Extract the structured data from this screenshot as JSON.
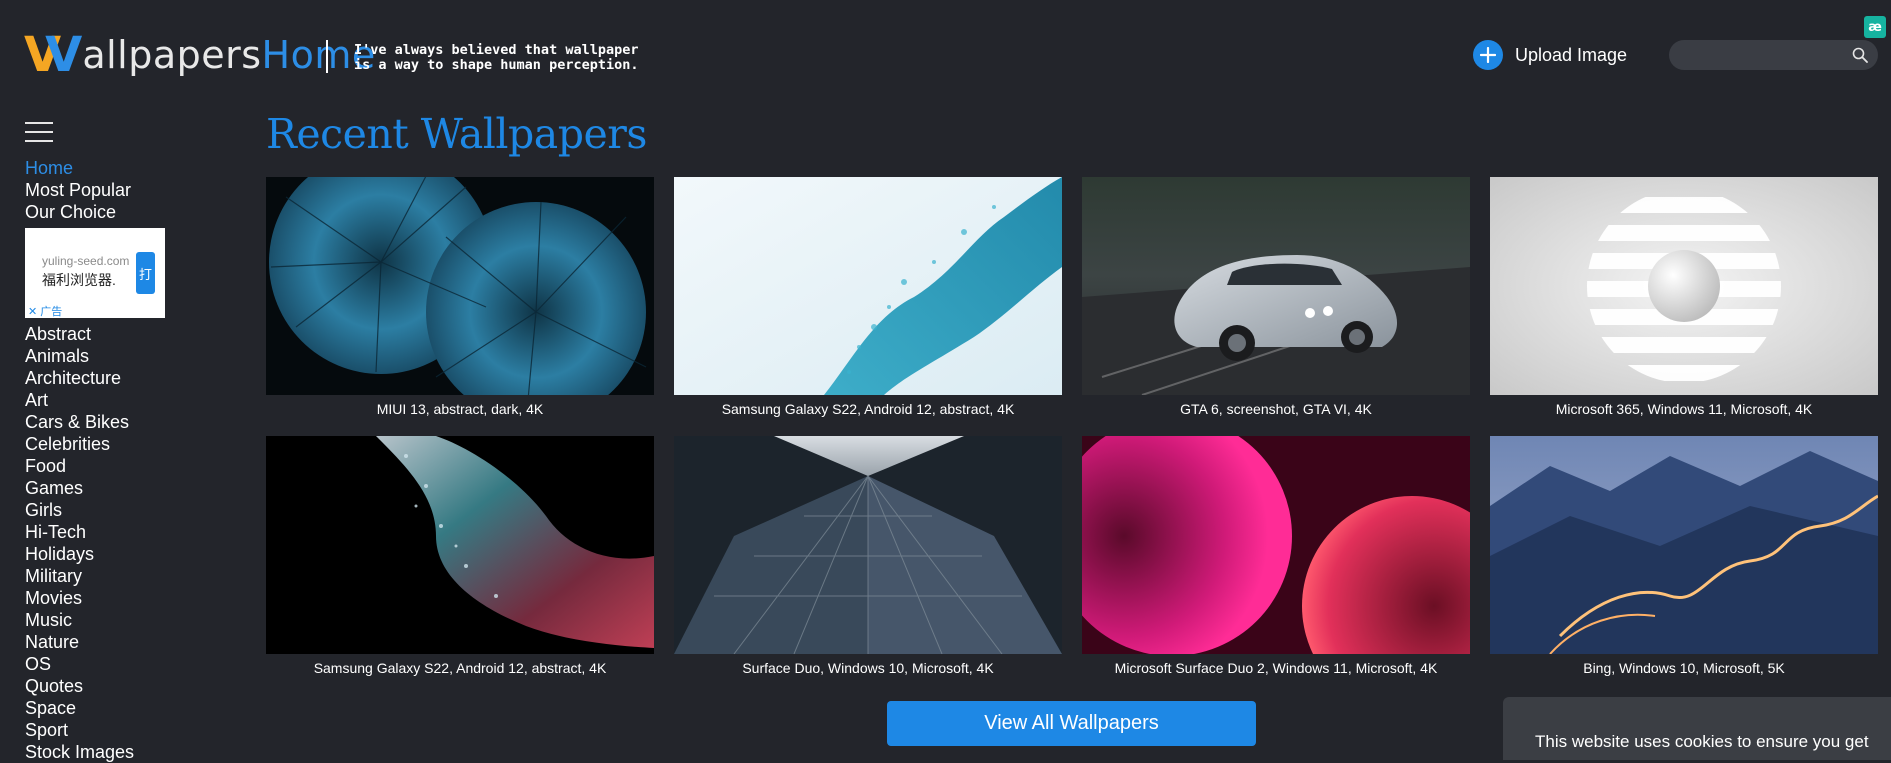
{
  "header": {
    "logo_part1": "allpapers",
    "logo_part2": "Home",
    "tagline": "I've always believed that wallpaper\nis a way to shape human perception.",
    "upload_label": "Upload Image",
    "search_placeholder": "",
    "corner_badge": "æ",
    "colors": {
      "accent": "#1e88e5",
      "logo_orange": "#f5a623",
      "background": "#23252b"
    }
  },
  "sidebar": {
    "nav": [
      {
        "label": "Home",
        "active": true
      },
      {
        "label": "Most Popular",
        "active": false
      },
      {
        "label": "Our Choice",
        "active": false
      }
    ],
    "ad": {
      "domain": "yuling-seed.com",
      "text": "福利浏览器.",
      "button": "打",
      "close_label": "✕ 广告"
    },
    "categories": [
      "Abstract",
      "Animals",
      "Architecture",
      "Art",
      "Cars & Bikes",
      "Celebrities",
      "Food",
      "Games",
      "Girls",
      "Hi-Tech",
      "Holidays",
      "Military",
      "Movies",
      "Music",
      "Nature",
      "OS",
      "Quotes",
      "Space",
      "Sport",
      "Stock Images"
    ]
  },
  "main": {
    "title": "Recent Wallpapers",
    "wallpapers": [
      {
        "caption": "MIUI 13, abstract, dark, 4K",
        "thumb": "thumb-miui-abstract-dark"
      },
      {
        "caption": "Samsung Galaxy S22, Android 12, abstract, 4K",
        "thumb": "thumb-blue-splash"
      },
      {
        "caption": "GTA 6, screenshot, GTA VI, 4K",
        "thumb": "thumb-silver-car"
      },
      {
        "caption": "Microsoft 365, Windows 11, Microsoft, 4K",
        "thumb": "thumb-white-sphere"
      },
      {
        "caption": "Samsung Galaxy S22, Android 12, abstract, 4K",
        "thumb": "thumb-particle-wave"
      },
      {
        "caption": "Surface Duo, Windows 10, Microsoft, 4K",
        "thumb": "thumb-glass-building"
      },
      {
        "caption": "Microsoft Surface Duo 2, Windows 11, Microsoft, 4K",
        "thumb": "thumb-pink-orbs"
      },
      {
        "caption": "Bing, Windows 10, Microsoft, 5K",
        "thumb": "thumb-mountain-road"
      }
    ],
    "view_all_label": "View All Wallpapers"
  },
  "cookie": {
    "text": "This website uses cookies to ensure you get"
  }
}
